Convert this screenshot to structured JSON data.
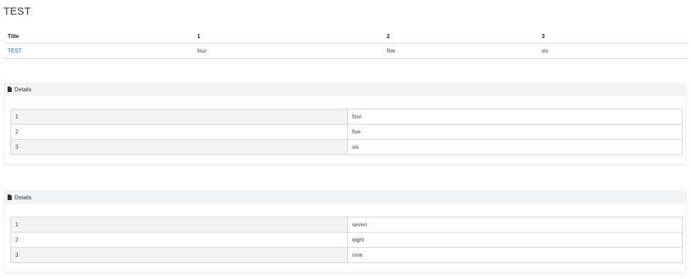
{
  "page": {
    "title": "TEST"
  },
  "summary_table": {
    "headers": [
      "Title",
      "1",
      "2",
      "3"
    ],
    "rows": [
      {
        "title": "TEST",
        "col1": "four",
        "col2": "five",
        "col3": "six"
      }
    ]
  },
  "panels": [
    {
      "heading": "Details",
      "rows": [
        {
          "key": "1",
          "value": "four"
        },
        {
          "key": "2",
          "value": "five"
        },
        {
          "key": "3",
          "value": "six"
        }
      ]
    },
    {
      "heading": "Details",
      "rows": [
        {
          "key": "1",
          "value": "seven"
        },
        {
          "key": "2",
          "value": "eight"
        },
        {
          "key": "3",
          "value": "nine"
        }
      ]
    }
  ],
  "icons": {
    "panel_heading": "document-icon"
  },
  "colors": {
    "link": "#2e6eb0",
    "panel_background": "#f3f4f6",
    "border": "#d4d4d4"
  }
}
